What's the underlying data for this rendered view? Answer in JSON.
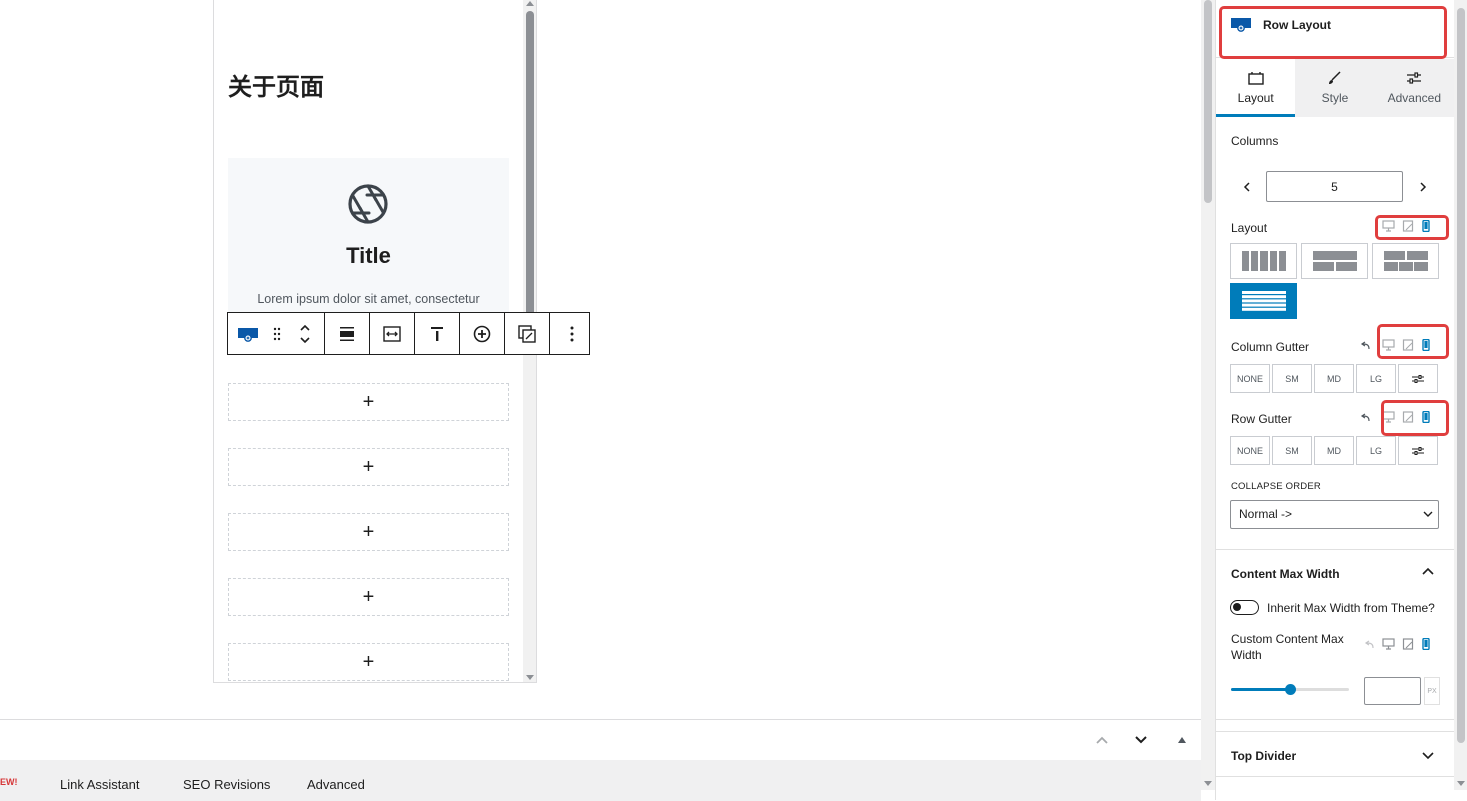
{
  "preview": {
    "heading": "关于页面",
    "box_title": "Title",
    "box_text": "Lorem ipsum dolor sit amet, consectetur",
    "add_slots": [
      "+",
      "+",
      "+",
      "+",
      "+"
    ]
  },
  "meta": {
    "new_badge": "EW!",
    "tabs": [
      "Link Assistant",
      "SEO Revisions",
      "Advanced"
    ]
  },
  "sidebar": {
    "block_title": "Row Layout",
    "tabs": [
      {
        "label": "Layout",
        "icon": "layout-icon",
        "active": true
      },
      {
        "label": "Style",
        "icon": "brush-icon",
        "active": false
      },
      {
        "label": "Advanced",
        "icon": "sliders-icon",
        "active": false
      }
    ],
    "columns_label": "Columns",
    "columns_value": "5",
    "layout_label": "Layout",
    "column_gutter_label": "Column Gutter",
    "row_gutter_label": "Row Gutter",
    "gutter_options": [
      "NONE",
      "SM",
      "MD",
      "LG"
    ],
    "collapse_order_label": "COLLAPSE ORDER",
    "collapse_order_value": "Normal ->",
    "content_max_width_title": "Content Max Width",
    "inherit_label": "Inherit Max Width from Theme?",
    "custom_width_label": "Custom Content Max Width",
    "slider_fraction": 0.5,
    "unit": "PX",
    "top_divider_title": "Top Divider"
  },
  "colors": {
    "accent": "#007cba",
    "highlight": "#e03e3e"
  }
}
